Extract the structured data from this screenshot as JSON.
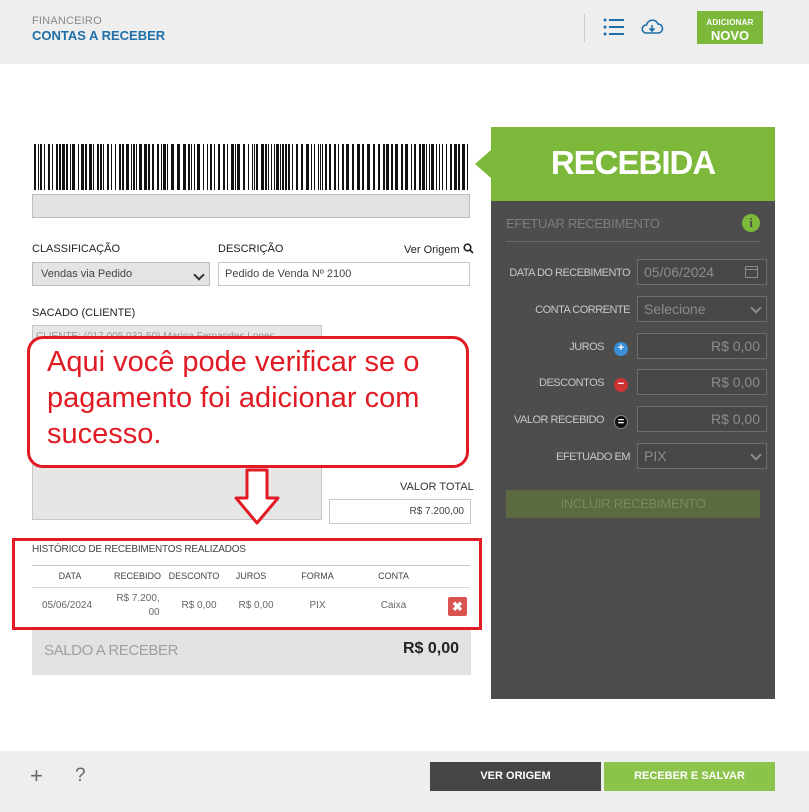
{
  "header": {
    "section": "FINANCEIRO",
    "title": "CONTAS A RECEBER",
    "new_button": {
      "line1": "ADICIONAR",
      "line2": "NOVO"
    },
    "icons": [
      "list-icon",
      "cloud-download-icon"
    ]
  },
  "form": {
    "classificacao": {
      "label": "CLASSIFICAÇÃO",
      "value": "Vendas via Pedido"
    },
    "descricao": {
      "label": "DESCRIÇÃO",
      "value": "Pedido de Venda Nº 2100"
    },
    "ver_origem_link": "Ver Origem",
    "sacado": {
      "label": "SACADO (CLIENTE)",
      "value": "CLIENTE: (017.005.032-50) Marina Fernandes Lopes"
    },
    "valor_total": {
      "label": "VALOR TOTAL",
      "value": "R$ 7.200,00"
    }
  },
  "annotation": {
    "text": "Aqui você pode verificar se o pagamento foi adicionar com sucesso."
  },
  "history": {
    "title": "HISTÓRICO DE RECEBIMENTOS REALIZADOS",
    "columns": [
      "DATA",
      "RECEBIDO",
      "DESCONTO",
      "JUROS",
      "FORMA",
      "CONTA"
    ],
    "rows": [
      {
        "data": "05/06/2024",
        "recebido_l1": "R$ 7.200,",
        "recebido_l2": "00",
        "desconto": "R$ 0,00",
        "juros": "R$ 0,00",
        "forma": "PIX",
        "conta": "Caixa"
      }
    ]
  },
  "saldo": {
    "label": "SALDO A RECEBER",
    "value": "R$ 0,00"
  },
  "panel": {
    "status": "RECEBIDA",
    "section_title": "EFETUAR RECEBIMENTO",
    "fields": {
      "data_recebimento": {
        "label": "DATA DO RECEBIMENTO",
        "value": "05/06/2024"
      },
      "conta_corrente": {
        "label": "CONTA CORRENTE",
        "value": "Selecione"
      },
      "juros": {
        "label": "JUROS",
        "value": "R$ 0,00"
      },
      "descontos": {
        "label": "DESCONTOS",
        "value": "R$ 0,00"
      },
      "valor_recebido": {
        "label": "VALOR RECEBIDO",
        "value": "R$ 0,00"
      },
      "efetuado_em": {
        "label": "EFETUADO EM",
        "value": "PIX"
      }
    },
    "incluir_button": "INCLUIR RECEBIMENTO"
  },
  "footer": {
    "plus": "+",
    "help": "?",
    "ver_origem": "VER ORIGEM",
    "receber_salvar": "RECEBER E SALVAR"
  },
  "colors": {
    "accent_green": "#7cb83a",
    "panel_dark": "#4d4d4d",
    "link_blue": "#1f6fa8",
    "annotation_red": "#e01b24"
  }
}
